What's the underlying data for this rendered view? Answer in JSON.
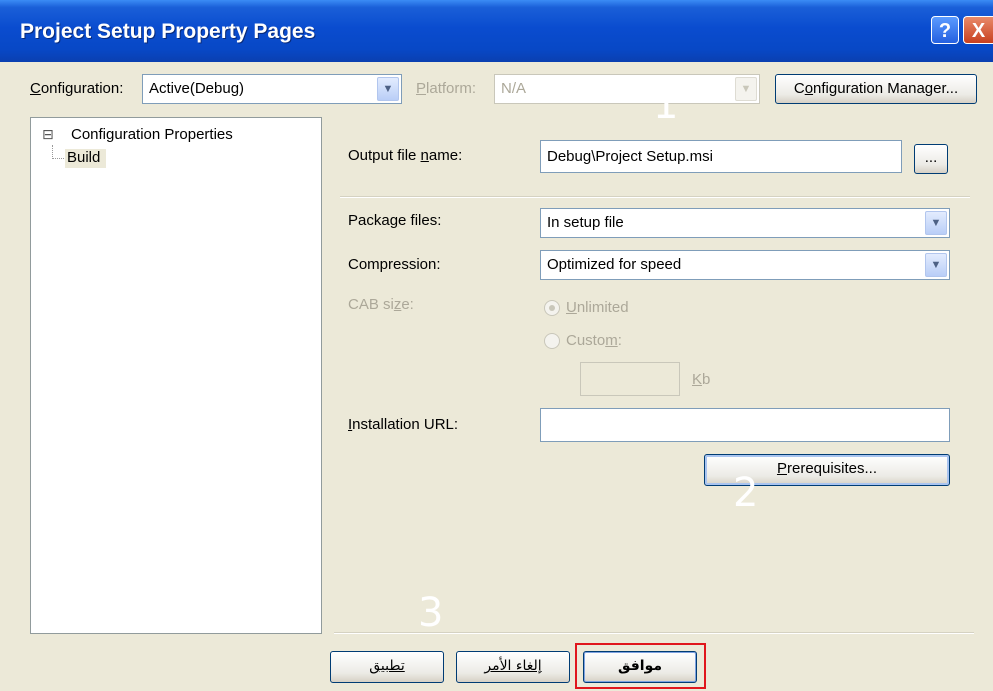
{
  "window": {
    "title": "Project Setup Property Pages",
    "help_glyph": "?",
    "close_glyph": "X"
  },
  "config_row": {
    "configuration_label_u": "C",
    "configuration_label_rest": "onfiguration:",
    "configuration_value": "Active(Debug)",
    "platform_label_u": "P",
    "platform_label_rest": "latform:",
    "platform_value": "N/A",
    "config_manager_u": "o",
    "config_manager_pre": "C",
    "config_manager_rest": "nfiguration Manager..."
  },
  "tree": {
    "root_label": "Configuration Properties",
    "root_toggle": "⊟",
    "child_label": "Build"
  },
  "form": {
    "output_label_pre": "Output file ",
    "output_label_u": "n",
    "output_label_rest": "ame:",
    "output_value": "Debug\\Project Setup.msi",
    "browse_label": "...",
    "package_label_pre": "Packa",
    "package_label_u": "g",
    "package_label_rest": "e files:",
    "package_value": "In setup file",
    "compression_label": "Compression:",
    "compression_value": "Optimized for speed",
    "cab_label_pre": "CAB si",
    "cab_label_u": "z",
    "cab_label_rest": "e:",
    "unlimited_u": "U",
    "unlimited_rest": "nlimited",
    "custom_pre": "Custo",
    "custom_u": "m",
    "custom_rest": ":",
    "kb_u": "K",
    "kb_rest": "b",
    "install_url_u": "I",
    "install_url_rest": "nstallation URL:",
    "install_url_value": "",
    "prereq_u": "P",
    "prereq_rest": "rerequisites..."
  },
  "annotations": {
    "n1": "1",
    "n2": "2",
    "n3": "3"
  },
  "footer": {
    "ok_label": "موافق",
    "cancel_label": "إلغاء الأمر",
    "apply_label": "تطبيق",
    "highlight_color": "#e0161c"
  }
}
